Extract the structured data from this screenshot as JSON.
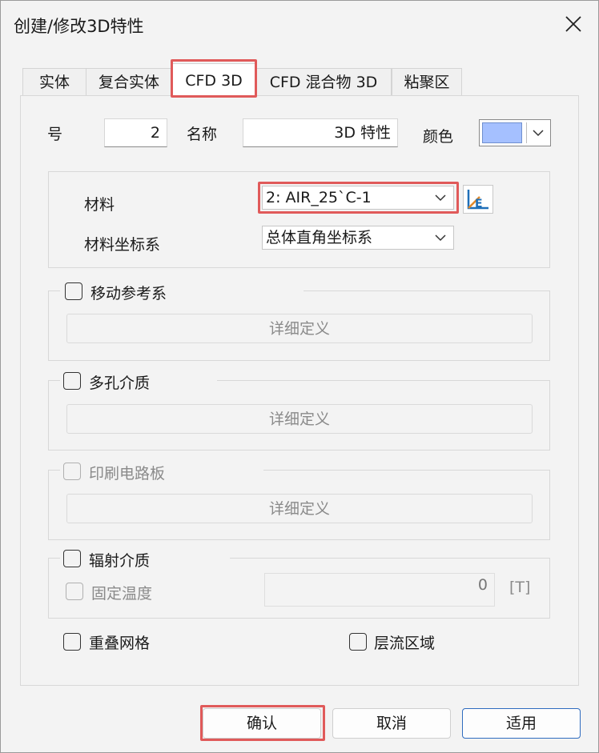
{
  "window": {
    "title": "创建/修改3D特性"
  },
  "tabs": [
    {
      "label": "实体"
    },
    {
      "label": "复合实体"
    },
    {
      "label": "CFD 3D",
      "active": true
    },
    {
      "label": "CFD 混合物 3D"
    },
    {
      "label": "粘聚区"
    }
  ],
  "props": {
    "number_label": "号",
    "number_value": "2",
    "name_label": "名称",
    "name_value": "3D 特性",
    "color_label": "颜色",
    "color_value": "#a5c0ff"
  },
  "material": {
    "material_label": "材料",
    "material_value": "2: AIR_25`C-1",
    "coord_label": "材料坐标系",
    "coord_value": "总体直角坐标系"
  },
  "groups": {
    "moving_ref": {
      "label": "移动参考系",
      "checked": false,
      "detail_label": "详细定义"
    },
    "porous": {
      "label": "多孔介质",
      "checked": false,
      "detail_label": "详细定义"
    },
    "pcb": {
      "label": "印刷电路板",
      "checked": false,
      "disabled": true,
      "detail_label": "详细定义"
    },
    "radiation": {
      "label": "辐射介质",
      "checked": false,
      "fixed_temp_label": "固定温度",
      "fixed_temp_value": "0",
      "unit": "[T]"
    }
  },
  "options": {
    "overlap_mesh": "重叠网格",
    "laminar_zone": "层流区域"
  },
  "buttons": {
    "ok": "确认",
    "cancel": "取消",
    "apply": "适用"
  }
}
